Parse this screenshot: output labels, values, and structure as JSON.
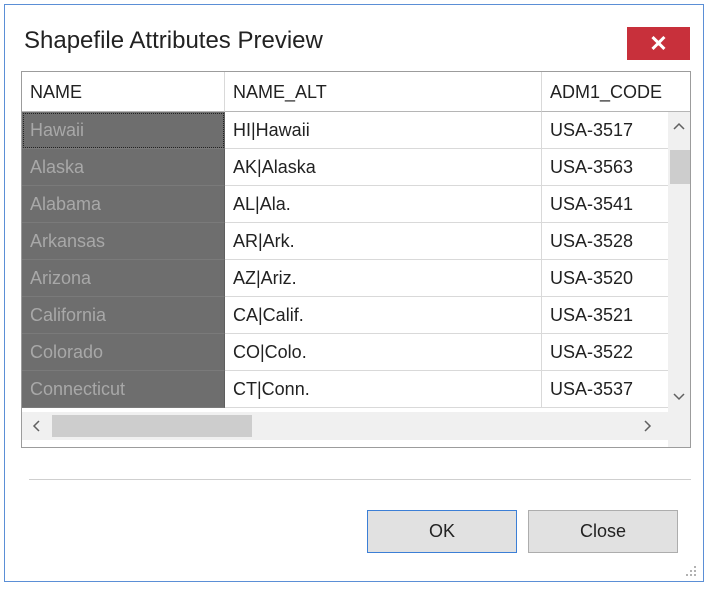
{
  "dialog": {
    "title": "Shapefile Attributes Preview",
    "close_glyph": "✕",
    "ok_label": "OK",
    "close_label": "Close"
  },
  "grid": {
    "columns": [
      "NAME",
      "NAME_ALT",
      "ADM1_CODE"
    ],
    "rows": [
      [
        "Hawaii",
        "HI|Hawaii",
        "USA-3517"
      ],
      [
        "Alaska",
        "AK|Alaska",
        "USA-3563"
      ],
      [
        "Alabama",
        "AL|Ala.",
        "USA-3541"
      ],
      [
        "Arkansas",
        "AR|Ark.",
        "USA-3528"
      ],
      [
        "Arizona",
        "AZ|Ariz.",
        "USA-3520"
      ],
      [
        "California",
        "CA|Calif.",
        "USA-3521"
      ],
      [
        "Colorado",
        "CO|Colo.",
        "USA-3522"
      ],
      [
        "Connecticut",
        "CT|Conn.",
        "USA-3537"
      ]
    ]
  },
  "icons": {
    "close": "close-icon",
    "scroll_up": "chevron-up-icon",
    "scroll_down": "chevron-down-icon",
    "scroll_left": "chevron-left-icon",
    "scroll_right": "chevron-right-icon",
    "resize_grip": "resize-grip-icon"
  },
  "colors": {
    "close_button": "#c8303b",
    "selected_column": "#6e6e6e",
    "ok_border": "#3c7fd6"
  }
}
